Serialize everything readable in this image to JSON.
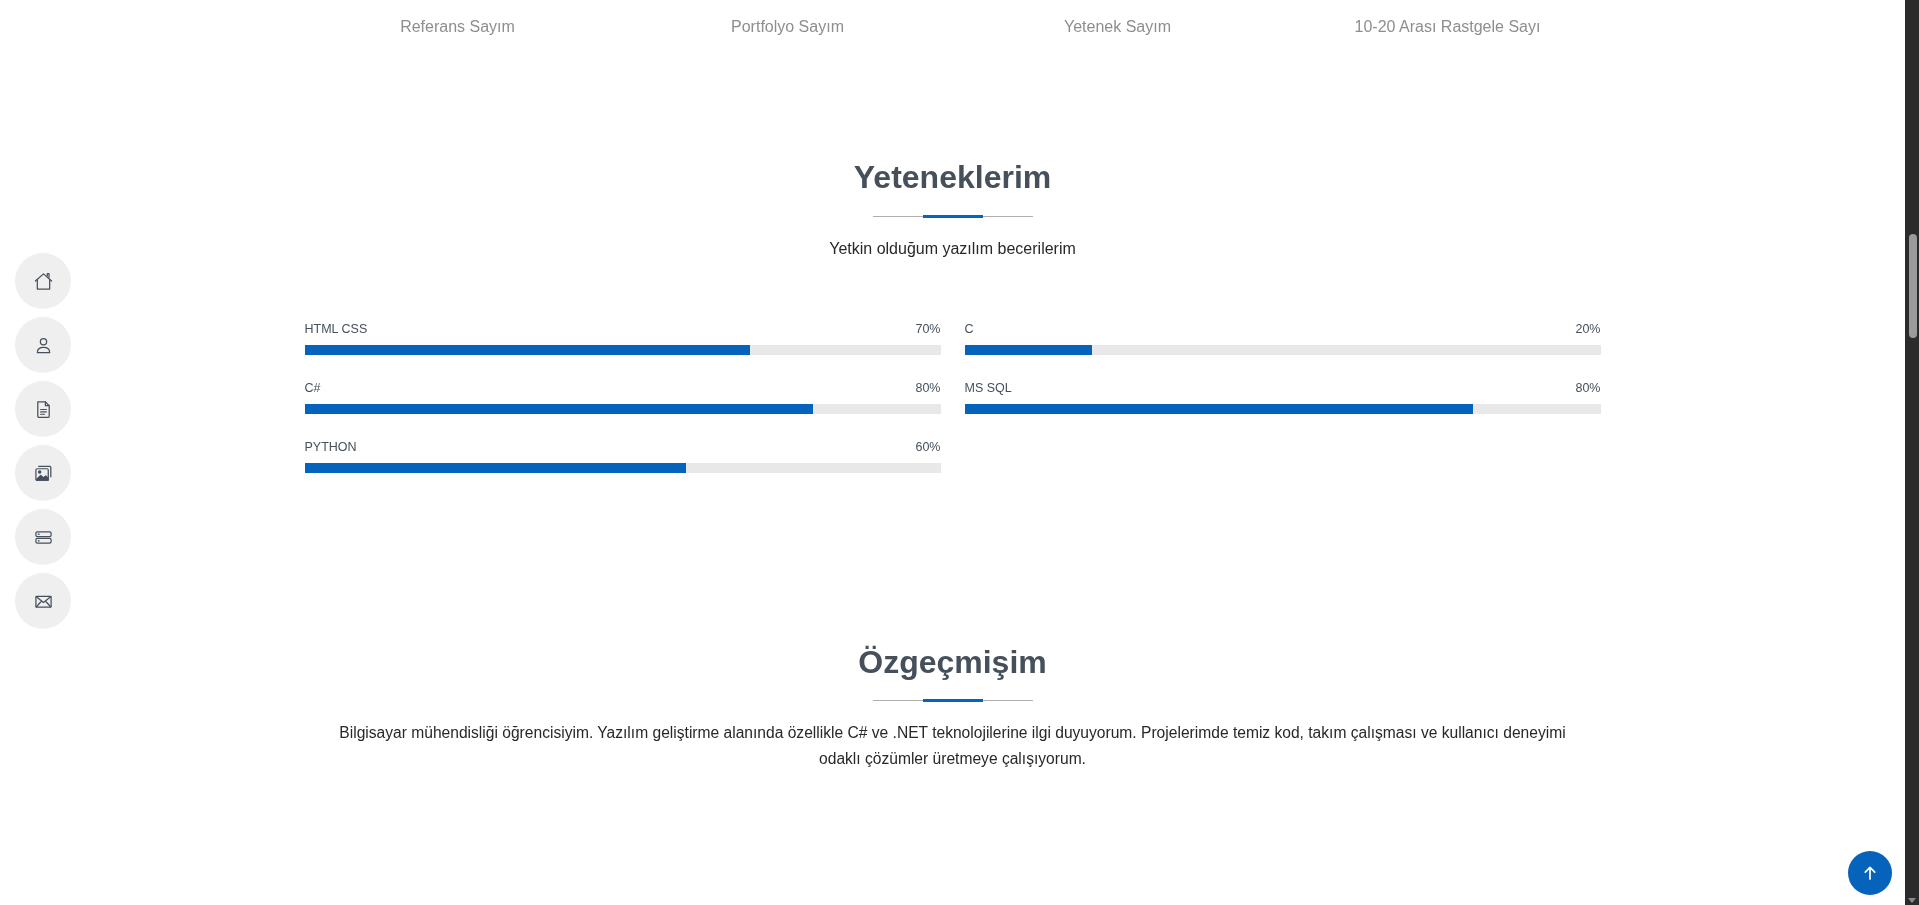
{
  "counters": [
    {
      "label": "Referans Sayım"
    },
    {
      "label": "Portfolyo Sayım"
    },
    {
      "label": "Yetenek Sayım"
    },
    {
      "label": "10-20 Arası Rastgele Sayı"
    }
  ],
  "skills_section": {
    "title": "Yeteneklerim",
    "subtitle": "Yetkin olduğum yazılım becerilerim",
    "columns": [
      {
        "skills": [
          {
            "name": "HTML CSS",
            "percent": "70%",
            "level": 0.7
          },
          {
            "name": "C#",
            "percent": "80%",
            "level": 0.8
          },
          {
            "name": "PYTHON",
            "percent": "60%",
            "level": 0.6
          }
        ]
      },
      {
        "skills": [
          {
            "name": "C",
            "percent": "20%",
            "level": 0.2
          },
          {
            "name": "MS SQL",
            "percent": "80%",
            "level": 0.8
          }
        ]
      }
    ]
  },
  "resume_section": {
    "title": "Özgeçmişim",
    "text": "Bilgisayar mühendisliği öğrencisiyim. Yazılım geliştirme alanında özellikle C# ve .NET teknolojilerine ilgi duyuyorum. Projelerimde temiz kod, takım çalışması ve kullanıcı deneyimi odaklı çözümler üretmeye çalışıyorum."
  },
  "side_nav": {
    "items": [
      {
        "kind": "home"
      },
      {
        "kind": "person"
      },
      {
        "kind": "document"
      },
      {
        "kind": "images"
      },
      {
        "kind": "server"
      },
      {
        "kind": "mail"
      }
    ]
  }
}
